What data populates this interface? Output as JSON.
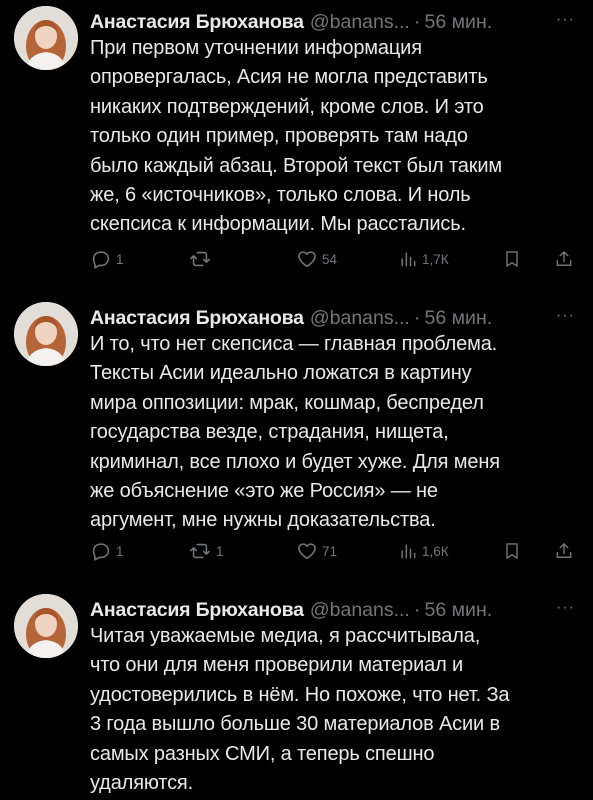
{
  "tweets": [
    {
      "author": "Анастасия Брюханова",
      "handle": "@banans...",
      "time": "56 мин.",
      "lines": [
        "При первом уточнении информация",
        "опровергалась, Асия не могла представить",
        "никаких подтверждений, кроме слов. И это",
        "только один пример, проверять там надо",
        "было каждый абзац. Второй текст был таким",
        "же, 6 «источников», только слова. И ноль",
        "скепсиса к информации. Мы расстались."
      ],
      "replies": "1",
      "retweets": "",
      "likes": "54",
      "views": "1,7К"
    },
    {
      "author": "Анастасия Брюханова",
      "handle": "@banans...",
      "time": "56 мин.",
      "lines": [
        "И то, что нет скепсиса — главная проблема.",
        "Тексты Асии идеально ложатся в картину",
        "мира оппозиции: мрак, кошмар, беспредел",
        "государства везде, страдания, нищета,",
        "криминал, все плохо и будет хуже. Для меня",
        "же объяснение «это же Россия» — не",
        "аргумент, мне нужны доказательства."
      ],
      "replies": "1",
      "retweets": "1",
      "likes": "71",
      "views": "1,6К"
    },
    {
      "author": "Анастасия Брюханова",
      "handle": "@banans...",
      "time": "56 мин.",
      "lines": [
        "Читая уважаемые медиа, я рассчитывала,",
        "что они для меня проверили материал и",
        "удостоверились в нём. Но похоже, что нет. За",
        "3 года вышло больше 30 материалов Асии в",
        "самых разных СМИ, а теперь спешно",
        "удаляются."
      ]
    }
  ],
  "separator": "·",
  "more_glyph": "···",
  "icons": {
    "reply": "reply-icon",
    "retweet": "retweet-icon",
    "like": "like-icon",
    "views": "views-icon",
    "bookmark": "bookmark-icon",
    "share": "share-icon"
  },
  "colors": {
    "background": "#000000",
    "text": "#e7e9ea",
    "muted": "#71767b"
  }
}
